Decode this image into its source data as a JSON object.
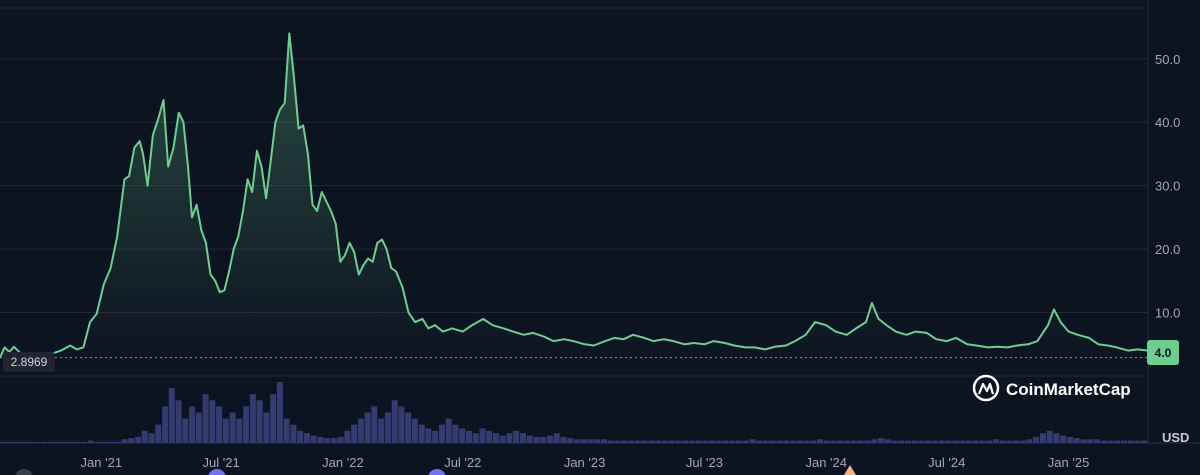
{
  "brand": "CoinMarketCap",
  "currency": "USD",
  "chart_data": {
    "type": "area",
    "title": "",
    "xlabel": "",
    "ylabel": "",
    "ylim": [
      0,
      58
    ],
    "y_ticks": [
      "10.0",
      "20.0",
      "30.0",
      "40.0",
      "50.0"
    ],
    "y_tick_values": [
      10,
      20,
      30,
      40,
      50
    ],
    "x_ticks": [
      "Jan '21",
      "Jul '21",
      "Jan '22",
      "Jul '22",
      "Jan '23",
      "Jul '23",
      "Jan '24",
      "Jul '24",
      "Jan '25"
    ],
    "x_tick_dates": [
      "2021-01-01",
      "2021-07-01",
      "2022-01-01",
      "2022-07-01",
      "2023-01-01",
      "2023-07-01",
      "2024-01-01",
      "2024-07-01",
      "2025-01-01"
    ],
    "x_range": [
      "2020-08-01",
      "2025-05-01"
    ],
    "start_label": "2.8969",
    "current_label": "4.0",
    "start_value": 2.8969,
    "current_value": 4.0,
    "grid": true,
    "line_color": "#6ccf8e",
    "series": [
      {
        "points": [
          [
            "2020-08-01",
            2.9
          ],
          [
            "2020-08-08",
            4.5
          ],
          [
            "2020-08-15",
            3.8
          ],
          [
            "2020-08-22",
            4.6
          ],
          [
            "2020-09-01",
            3.6
          ],
          [
            "2020-09-15",
            2.9
          ],
          [
            "2020-10-01",
            3.1
          ],
          [
            "2020-10-15",
            3.4
          ],
          [
            "2020-11-01",
            4.0
          ],
          [
            "2020-11-15",
            4.8
          ],
          [
            "2020-11-25",
            4.2
          ],
          [
            "2020-12-05",
            4.5
          ],
          [
            "2020-12-15",
            8.5
          ],
          [
            "2020-12-25",
            9.8
          ],
          [
            "2021-01-05",
            14.5
          ],
          [
            "2021-01-15",
            17.0
          ],
          [
            "2021-01-25",
            22.0
          ],
          [
            "2021-02-05",
            31.0
          ],
          [
            "2021-02-12",
            31.5
          ],
          [
            "2021-02-20",
            36.0
          ],
          [
            "2021-02-28",
            37.0
          ],
          [
            "2021-03-05",
            35.0
          ],
          [
            "2021-03-12",
            30.0
          ],
          [
            "2021-03-20",
            38.0
          ],
          [
            "2021-03-28",
            40.5
          ],
          [
            "2021-04-05",
            43.5
          ],
          [
            "2021-04-12",
            33.0
          ],
          [
            "2021-04-20",
            36.0
          ],
          [
            "2021-04-28",
            41.5
          ],
          [
            "2021-05-05",
            40.0
          ],
          [
            "2021-05-12",
            33.0
          ],
          [
            "2021-05-18",
            25.0
          ],
          [
            "2021-05-25",
            27.0
          ],
          [
            "2021-06-01",
            23.0
          ],
          [
            "2021-06-08",
            21.0
          ],
          [
            "2021-06-15",
            16.0
          ],
          [
            "2021-06-22",
            15.0
          ],
          [
            "2021-06-29",
            13.2
          ],
          [
            "2021-07-06",
            13.5
          ],
          [
            "2021-07-13",
            16.5
          ],
          [
            "2021-07-20",
            20.0
          ],
          [
            "2021-07-27",
            22.0
          ],
          [
            "2021-08-03",
            26.0
          ],
          [
            "2021-08-10",
            31.0
          ],
          [
            "2021-08-17",
            29.0
          ],
          [
            "2021-08-24",
            35.5
          ],
          [
            "2021-08-31",
            33.0
          ],
          [
            "2021-09-07",
            28.0
          ],
          [
            "2021-09-14",
            34.0
          ],
          [
            "2021-09-21",
            40.0
          ],
          [
            "2021-09-28",
            42.0
          ],
          [
            "2021-10-05",
            43.0
          ],
          [
            "2021-10-12",
            54.0
          ],
          [
            "2021-10-19",
            47.0
          ],
          [
            "2021-10-26",
            39.0
          ],
          [
            "2021-11-02",
            39.5
          ],
          [
            "2021-11-09",
            35.0
          ],
          [
            "2021-11-16",
            27.0
          ],
          [
            "2021-11-23",
            26.0
          ],
          [
            "2021-11-30",
            29.0
          ],
          [
            "2021-12-07",
            27.5
          ],
          [
            "2021-12-14",
            26.0
          ],
          [
            "2021-12-21",
            24.0
          ],
          [
            "2021-12-28",
            18.0
          ],
          [
            "2022-01-04",
            19.0
          ],
          [
            "2022-01-11",
            21.0
          ],
          [
            "2022-01-18",
            19.5
          ],
          [
            "2022-01-25",
            16.0
          ],
          [
            "2022-02-01",
            17.5
          ],
          [
            "2022-02-08",
            18.5
          ],
          [
            "2022-02-15",
            18.0
          ],
          [
            "2022-02-22",
            21.0
          ],
          [
            "2022-03-01",
            21.5
          ],
          [
            "2022-03-08",
            20.0
          ],
          [
            "2022-03-15",
            17.0
          ],
          [
            "2022-03-22",
            16.5
          ],
          [
            "2022-04-01",
            14.0
          ],
          [
            "2022-04-10",
            10.0
          ],
          [
            "2022-04-20",
            8.5
          ],
          [
            "2022-05-01",
            9.0
          ],
          [
            "2022-05-10",
            7.5
          ],
          [
            "2022-05-20",
            8.0
          ],
          [
            "2022-06-01",
            7.0
          ],
          [
            "2022-06-15",
            7.5
          ],
          [
            "2022-07-01",
            7.0
          ],
          [
            "2022-07-15",
            8.0
          ],
          [
            "2022-08-01",
            9.0
          ],
          [
            "2022-08-15",
            8.0
          ],
          [
            "2022-09-01",
            7.5
          ],
          [
            "2022-09-15",
            7.0
          ],
          [
            "2022-10-01",
            6.5
          ],
          [
            "2022-10-15",
            6.8
          ],
          [
            "2022-11-01",
            6.2
          ],
          [
            "2022-11-15",
            5.5
          ],
          [
            "2022-12-01",
            5.8
          ],
          [
            "2022-12-15",
            5.5
          ],
          [
            "2023-01-01",
            5.0
          ],
          [
            "2023-01-15",
            4.8
          ],
          [
            "2023-02-01",
            5.5
          ],
          [
            "2023-02-15",
            6.0
          ],
          [
            "2023-03-01",
            5.8
          ],
          [
            "2023-03-15",
            6.5
          ],
          [
            "2023-04-01",
            6.0
          ],
          [
            "2023-04-15",
            5.5
          ],
          [
            "2023-05-01",
            5.8
          ],
          [
            "2023-05-15",
            5.5
          ],
          [
            "2023-06-01",
            5.0
          ],
          [
            "2023-06-15",
            5.2
          ],
          [
            "2023-07-01",
            5.0
          ],
          [
            "2023-07-15",
            5.5
          ],
          [
            "2023-08-01",
            5.2
          ],
          [
            "2023-08-15",
            4.8
          ],
          [
            "2023-09-01",
            4.5
          ],
          [
            "2023-09-15",
            4.5
          ],
          [
            "2023-10-01",
            4.2
          ],
          [
            "2023-10-15",
            4.6
          ],
          [
            "2023-11-01",
            4.8
          ],
          [
            "2023-11-15",
            5.5
          ],
          [
            "2023-12-01",
            6.5
          ],
          [
            "2023-12-15",
            8.5
          ],
          [
            "2024-01-01",
            8.0
          ],
          [
            "2024-01-15",
            7.0
          ],
          [
            "2024-02-01",
            6.5
          ],
          [
            "2024-02-15",
            7.5
          ],
          [
            "2024-03-01",
            8.5
          ],
          [
            "2024-03-10",
            11.5
          ],
          [
            "2024-03-20",
            9.0
          ],
          [
            "2024-04-01",
            8.0
          ],
          [
            "2024-04-15",
            7.0
          ],
          [
            "2024-05-01",
            6.5
          ],
          [
            "2024-05-15",
            7.0
          ],
          [
            "2024-06-01",
            6.8
          ],
          [
            "2024-06-15",
            5.8
          ],
          [
            "2024-07-01",
            5.5
          ],
          [
            "2024-07-15",
            6.0
          ],
          [
            "2024-08-01",
            5.0
          ],
          [
            "2024-08-15",
            4.8
          ],
          [
            "2024-09-01",
            4.5
          ],
          [
            "2024-09-15",
            4.6
          ],
          [
            "2024-10-01",
            4.5
          ],
          [
            "2024-10-15",
            4.8
          ],
          [
            "2024-11-01",
            5.0
          ],
          [
            "2024-11-15",
            5.5
          ],
          [
            "2024-12-01",
            8.0
          ],
          [
            "2024-12-10",
            10.5
          ],
          [
            "2024-12-20",
            8.5
          ],
          [
            "2025-01-01",
            7.0
          ],
          [
            "2025-01-15",
            6.5
          ],
          [
            "2025-02-01",
            6.0
          ],
          [
            "2025-02-15",
            5.0
          ],
          [
            "2025-03-01",
            4.8
          ],
          [
            "2025-03-15",
            4.5
          ],
          [
            "2025-04-01",
            4.0
          ],
          [
            "2025-04-15",
            4.2
          ],
          [
            "2025-05-01",
            4.0
          ]
        ]
      }
    ],
    "volume": {
      "color": "#343b71",
      "values": [
        1,
        1,
        1,
        1,
        1,
        1,
        1,
        1,
        1,
        1,
        1,
        1,
        1,
        2,
        1,
        1,
        1,
        1,
        3,
        4,
        5,
        10,
        8,
        15,
        30,
        45,
        35,
        20,
        30,
        25,
        40,
        35,
        30,
        20,
        25,
        20,
        30,
        40,
        35,
        25,
        40,
        50,
        20,
        15,
        10,
        8,
        6,
        5,
        4,
        4,
        5,
        10,
        15,
        20,
        25,
        30,
        20,
        25,
        35,
        30,
        25,
        20,
        15,
        12,
        10,
        15,
        20,
        15,
        12,
        10,
        8,
        12,
        10,
        8,
        6,
        8,
        10,
        8,
        6,
        5,
        5,
        6,
        8,
        5,
        4,
        3,
        3,
        3,
        3,
        3,
        2,
        2,
        2,
        2,
        2,
        2,
        2,
        2,
        2,
        2,
        2,
        2,
        2,
        2,
        2,
        2,
        2,
        2,
        2,
        2,
        2,
        3,
        2,
        2,
        2,
        2,
        2,
        2,
        2,
        2,
        2,
        3,
        2,
        2,
        2,
        2,
        2,
        2,
        2,
        3,
        4,
        3,
        2,
        2,
        2,
        2,
        2,
        2,
        2,
        2,
        2,
        2,
        2,
        2,
        2,
        2,
        2,
        3,
        2,
        2,
        2,
        2,
        3,
        5,
        8,
        10,
        8,
        6,
        5,
        4,
        3,
        3,
        3,
        2,
        2,
        2,
        2,
        2,
        2,
        2
      ]
    }
  }
}
